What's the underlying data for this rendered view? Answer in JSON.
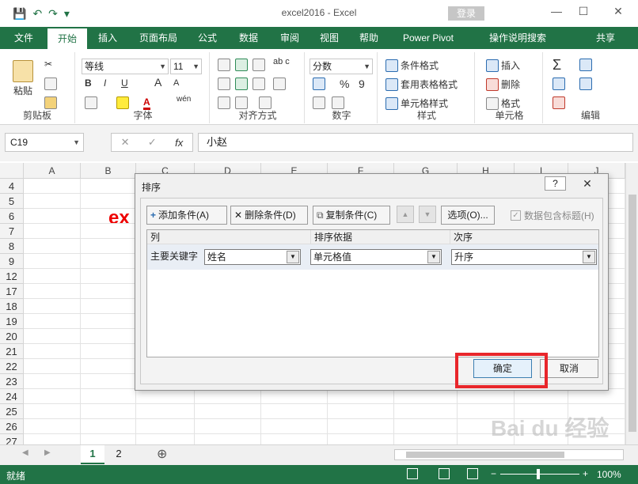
{
  "window": {
    "title": "excel2016  -  Excel",
    "login_label": "登录",
    "min_icon": "—",
    "restore_icon": "☐",
    "close_icon": "✕"
  },
  "qat": {
    "save_icon": "💾",
    "undo_icon": "↶",
    "redo_icon": "↷",
    "extra_icon": "▾"
  },
  "tabs": [
    "文件",
    "开始",
    "插入",
    "页面布局",
    "公式",
    "数据",
    "审阅",
    "视图",
    "帮助",
    "Power Pivot",
    "操作说明搜索"
  ],
  "share_label": "共享",
  "ribbon": {
    "clipboard": {
      "paste": "粘贴",
      "label": "剪贴板"
    },
    "font": {
      "name": "等线",
      "size": "11",
      "bold": "B",
      "italic": "I",
      "underline": "U",
      "grow": "A",
      "shrink": "A",
      "label": "字体"
    },
    "align": {
      "label": "对齐方式",
      "wrap": "ab c"
    },
    "number": {
      "format": "分数",
      "percent": "%",
      "comma": "9",
      "label": "数字"
    },
    "styles": {
      "cond": "条件格式",
      "table": "套用表格格式",
      "cell": "单元格样式",
      "label": "样式"
    },
    "cells": {
      "insert": "插入",
      "delete": "删除",
      "format": "格式",
      "label": "单元格"
    },
    "edit": {
      "sum": "Σ",
      "label": "编辑"
    }
  },
  "formula_bar": {
    "name_box": "C19",
    "fx": "fx",
    "content": "小赵"
  },
  "grid": {
    "columns": [
      "A",
      "B",
      "C",
      "D",
      "E",
      "F",
      "G",
      "H",
      "I",
      "J"
    ],
    "rows": [
      "4",
      "5",
      "6",
      "7",
      "8",
      "9",
      "12",
      "17",
      "18",
      "19",
      "20",
      "21",
      "22",
      "23",
      "24",
      "25",
      "26",
      "27"
    ],
    "cell_text": "ex"
  },
  "sheets": [
    "1",
    "2"
  ],
  "status": {
    "ready": "就绪",
    "zoom": "100%"
  },
  "dialog": {
    "title": "排序",
    "help": "?",
    "add": "添加条件(A)",
    "delete": "删除条件(D)",
    "copy": "复制条件(C)",
    "options": "选项(O)...",
    "header_check": "数据包含标题(H)",
    "col_header": "列",
    "sort_on_header": "排序依据",
    "order_header": "次序",
    "row_label": "主要关键字",
    "col_value": "姓名",
    "sort_on_value": "单元格值",
    "order_value": "升序",
    "ok": "确定",
    "cancel": "取消"
  },
  "watermark": "Bai du 经验",
  "colors": {
    "excel_green": "#217346",
    "highlight_red": "#e8262b"
  }
}
